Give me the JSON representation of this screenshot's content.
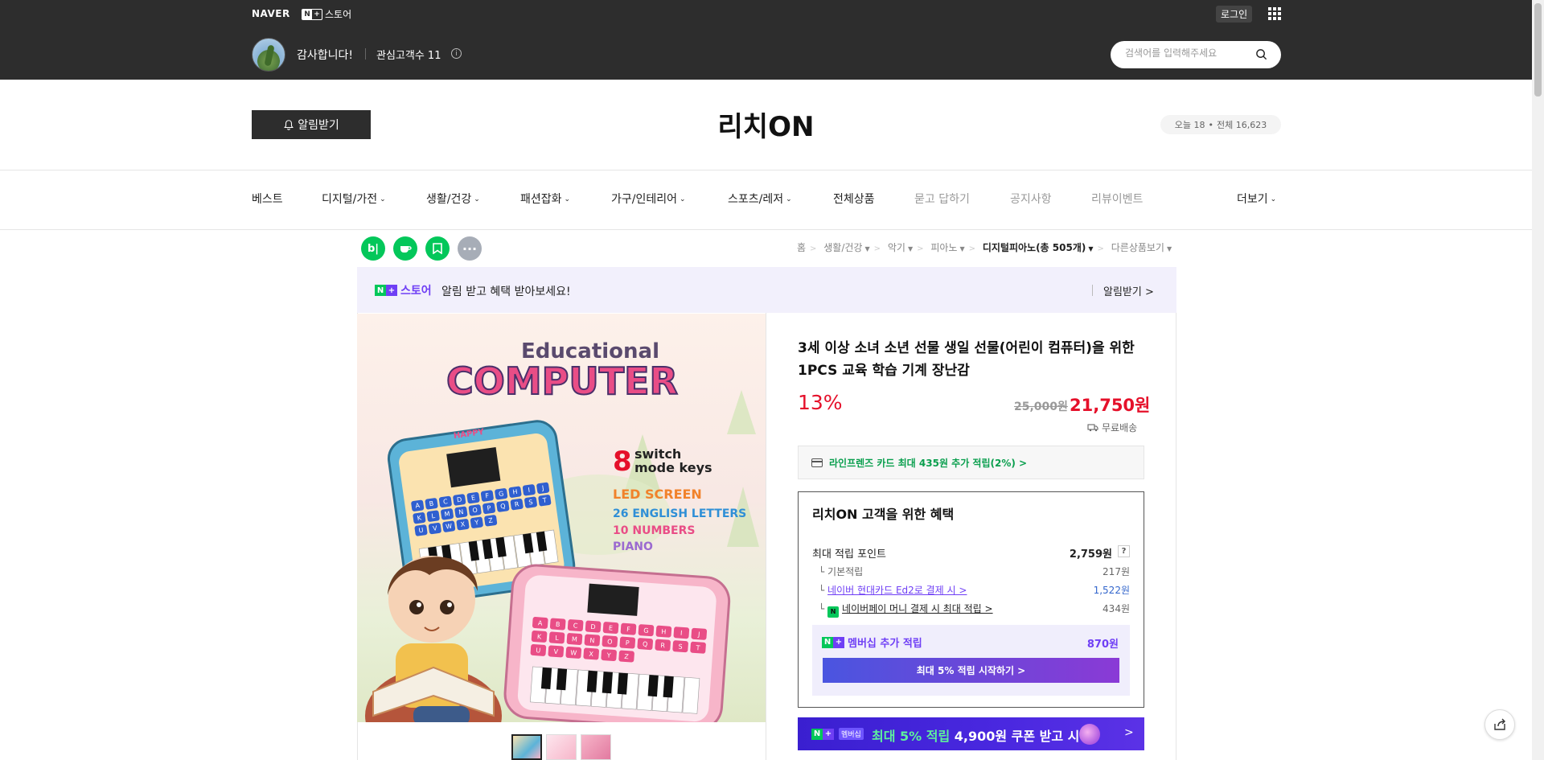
{
  "header": {
    "naver_logo": "NAVER",
    "store_badge_text": "스토어",
    "login": "로그인",
    "greeting": "감사합니다!",
    "interest_label": "관심고객수 11",
    "search_placeholder": "검색어를 입력해주세요"
  },
  "store": {
    "alarm_button": "알림받기",
    "title": "리치ON",
    "visits_today": "오늘 18",
    "visits_total": "전체 16,623"
  },
  "nav": {
    "items": [
      {
        "label": "베스트"
      },
      {
        "label": "디지털/가전"
      },
      {
        "label": "생활/건강"
      },
      {
        "label": "패션잡화"
      },
      {
        "label": "가구/인테리어"
      },
      {
        "label": "스포츠/레저"
      },
      {
        "label": "전체상품"
      },
      {
        "label": "묻고 답하기"
      },
      {
        "label": "공지사항"
      },
      {
        "label": "리뷰이벤트"
      }
    ],
    "more": "더보기"
  },
  "share": {
    "blog_label": "b|"
  },
  "breadcrumb": {
    "items": [
      "홈",
      "생활/건강",
      "악기",
      "피아노",
      "디지털피아노(총 505개)",
      "다른상품보기"
    ]
  },
  "notice": {
    "brand": "스토어",
    "text": "알림 받고 혜택 받아보세요!",
    "button": "알림받기 >"
  },
  "product": {
    "image": {
      "heading": "Educational",
      "logo": "COMPUTER",
      "switch_count": "8",
      "switch_line1": "switch",
      "switch_line2": "mode keys",
      "feature1": "LED SCREEN",
      "feature2": "26 ENGLISH LETTERS",
      "feature3": "10 NUMBERS",
      "feature4": "PIANO",
      "device_label": "HAPPY",
      "keys": [
        "A",
        "B",
        "C",
        "D",
        "E",
        "F",
        "G",
        "H",
        "I",
        "J",
        "K",
        "L",
        "M",
        "N",
        "O",
        "P",
        "Q",
        "R",
        "S",
        "T",
        "U",
        "V",
        "W",
        "X",
        "Y",
        "Z"
      ]
    },
    "title": "3세 이상 소녀 소년 선물 생일 선물(어린이 컴퓨터)을 위한 1PCS 교육 학습 기계 장난감",
    "discount": "13%",
    "original_price": "25,000원",
    "sale_price": "21,750원",
    "shipping": "무료배송",
    "card_benefit": "라인프렌즈 카드 최대 435원 추가 적립(2%) >"
  },
  "benefit": {
    "title": "리치ON 고객을 위한 혜택",
    "max_points_label": "최대 적립 포인트",
    "max_points_value": "2,759원",
    "rows": [
      {
        "label": "기본적립",
        "value": "217원"
      },
      {
        "label": "네이버 현대카드 Ed2로 결제 시 >",
        "value": "1,522원"
      },
      {
        "label": "네이버페이 머니 결제 시 최대 적립 >",
        "value": "434원"
      }
    ],
    "membership_label": "멤버십 추가 적립",
    "membership_value": "870원",
    "membership_button": "최대 5% 적립 시작하기 >"
  },
  "promo": {
    "badge": "멤버십",
    "text_highlight": "최대 5% 적립",
    "text_rest": "4,900원 쿠폰 받고 시작"
  },
  "colors": {
    "header_bg": "#2d2d2d",
    "naver_green": "#03c75a",
    "purple": "#6f3ff5",
    "sale_red": "#e5102a"
  }
}
